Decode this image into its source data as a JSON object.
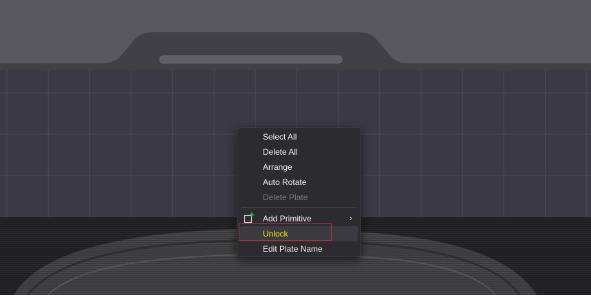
{
  "context_menu": {
    "items": [
      {
        "label": "Select All",
        "enabled": true
      },
      {
        "label": "Delete All",
        "enabled": true
      },
      {
        "label": "Arrange",
        "enabled": true
      },
      {
        "label": "Auto Rotate",
        "enabled": true
      },
      {
        "label": "Delete Plate",
        "enabled": false
      },
      {
        "label": "Add Primitive",
        "enabled": true,
        "icon": "add-primitive-icon",
        "has_submenu": true
      },
      {
        "label": "Unlock",
        "enabled": true,
        "highlighted": true
      },
      {
        "label": "Edit Plate Name",
        "enabled": true
      }
    ]
  },
  "colors": {
    "highlight_text": "#f5e800",
    "annotation_border": "#d23030",
    "plate_grid": "#4a4955",
    "icon_plus": "#22c55e"
  }
}
